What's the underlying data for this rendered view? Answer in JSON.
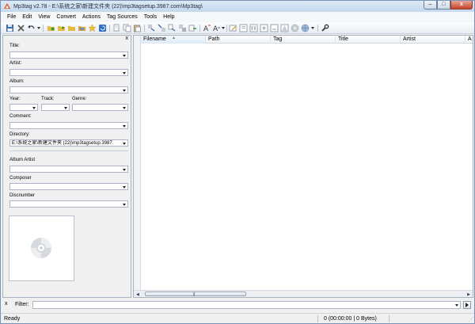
{
  "window": {
    "title": "Mp3tag v2.78  -  E:\\系统之家\\新建文件夹 (22)\\mp3tagsetup.3987.com\\Mp3tag\\",
    "controls": {
      "minimize": "–",
      "maximize": "□",
      "close": "x"
    }
  },
  "menu": [
    "File",
    "Edit",
    "View",
    "Convert",
    "Actions",
    "Tag Sources",
    "Tools",
    "Help"
  ],
  "tag_panel": {
    "close": "x",
    "fields": {
      "title": {
        "label": "Title:",
        "value": ""
      },
      "artist": {
        "label": "Artist:",
        "value": ""
      },
      "album": {
        "label": "Album:",
        "value": ""
      },
      "year": {
        "label": "Year:",
        "value": ""
      },
      "track": {
        "label": "Track:",
        "value": ""
      },
      "genre": {
        "label": "Genre:",
        "value": ""
      },
      "comment": {
        "label": "Comment:",
        "value": ""
      },
      "directory": {
        "label": "Directory:",
        "value": "E:\\系统之家\\新建文件夹 (22)\\mp3tagsetup.3987."
      },
      "album_artist": {
        "label": "Album Artist",
        "value": ""
      },
      "composer": {
        "label": "Composer",
        "value": ""
      },
      "discnumber": {
        "label": "Discnumber",
        "value": ""
      }
    }
  },
  "file_list": {
    "columns": [
      "Filename",
      "Path",
      "Tag",
      "Title",
      "Artist",
      "A"
    ],
    "sorted_column": "Filename",
    "rows": []
  },
  "filter": {
    "label": "Filter:",
    "value": "",
    "close": "x"
  },
  "status": {
    "text": "Ready",
    "info": "0 (00:00:00 | 0 Bytes)"
  },
  "colors": {
    "accent": "#3a7fc6",
    "title_bar": "#c4d7ee",
    "close_button": "#c7432b"
  }
}
